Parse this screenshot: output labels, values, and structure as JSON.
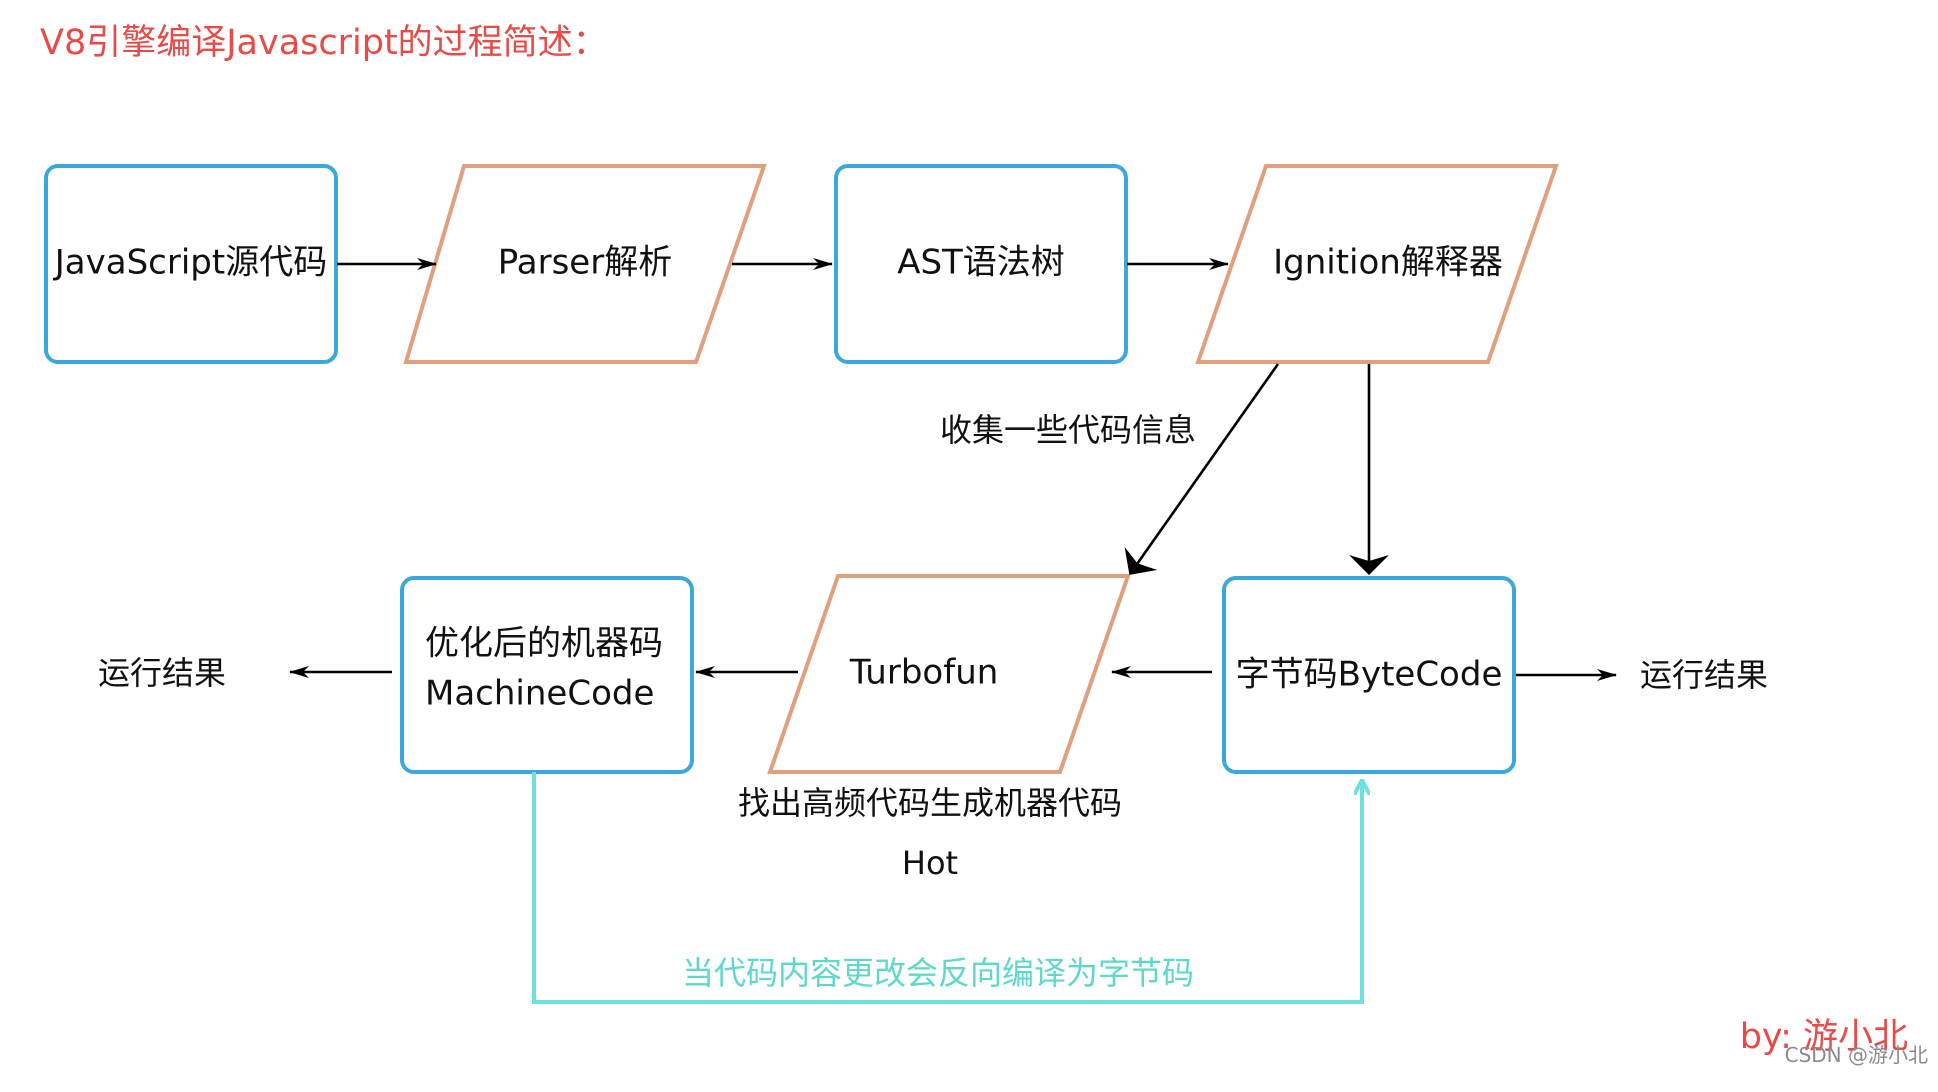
{
  "title": "V8引擎编译Javascript的过程简述：",
  "nodes": {
    "js_source": "JavaScript源代码",
    "parser": "Parser解析",
    "ast": "AST语法树",
    "ignition": "Ignition解释器",
    "bytecode": "字节码ByteCode",
    "turbofan": "Turbofun",
    "machine_line1": "优化后的机器码",
    "machine_line2": "MachineCode"
  },
  "labels": {
    "collect_info": "收集一些代码信息",
    "hot_code": "找出高频代码生成机器代码",
    "hot": "Hot",
    "result_left": "运行结果",
    "result_right": "运行结果",
    "deopt": "当代码内容更改会反向编译为字节码"
  },
  "author": "by: 游小北",
  "watermark": "CSDN @游小北",
  "colors": {
    "box_stroke": "#3aa8dc",
    "parallelogram_stroke": "#e0a07e",
    "title_red": "#e84a47",
    "deopt_cyan": "#6fe0df"
  }
}
